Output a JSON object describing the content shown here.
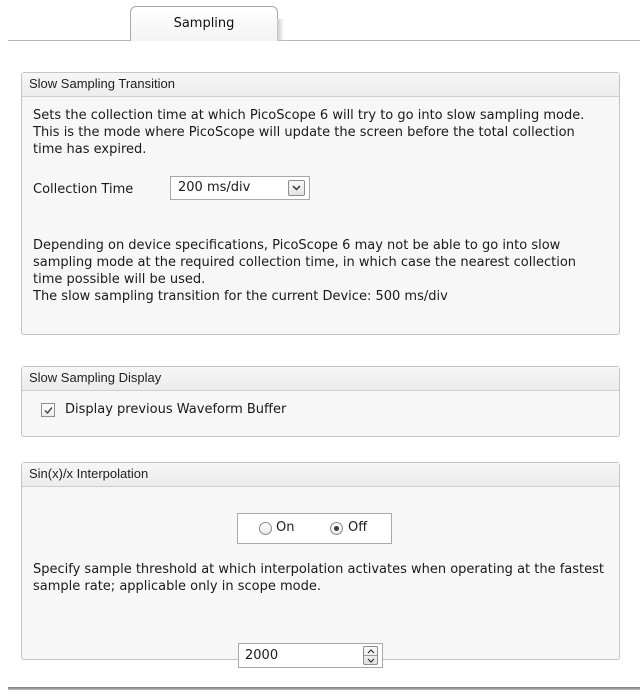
{
  "tabs": [
    {
      "label": "Sampling"
    }
  ],
  "slow_transition": {
    "title": "Slow Sampling Transition",
    "description": "Sets the collection time at which PicoScope 6 will try to go into slow sampling mode. This is the mode where PicoScope will update the screen before the total collection time has expired.",
    "collection_label": "Collection Time",
    "collection_value": "200 ms/div",
    "note": "Depending on device specifications, PicoScope 6 may not be able to go into slow sampling mode at the required collection time, in which case the nearest collection time possible will be used.",
    "current_device": "The slow sampling transition for the current Device: 500 ms/div"
  },
  "slow_display": {
    "title": "Slow Sampling Display",
    "checkbox_label": "Display previous Waveform Buffer",
    "checked": true
  },
  "interpolation": {
    "title": "Sin(x)/x Interpolation",
    "on_label": "On",
    "off_label": "Off",
    "selected": "Off",
    "description": "Specify sample threshold at which interpolation activates when operating at the fastest sample rate; applicable only in scope mode.",
    "threshold_value": "2000"
  },
  "icons": [
    "chevron-down-icon",
    "checkmark-icon",
    "spin-up-icon",
    "spin-down-icon"
  ]
}
